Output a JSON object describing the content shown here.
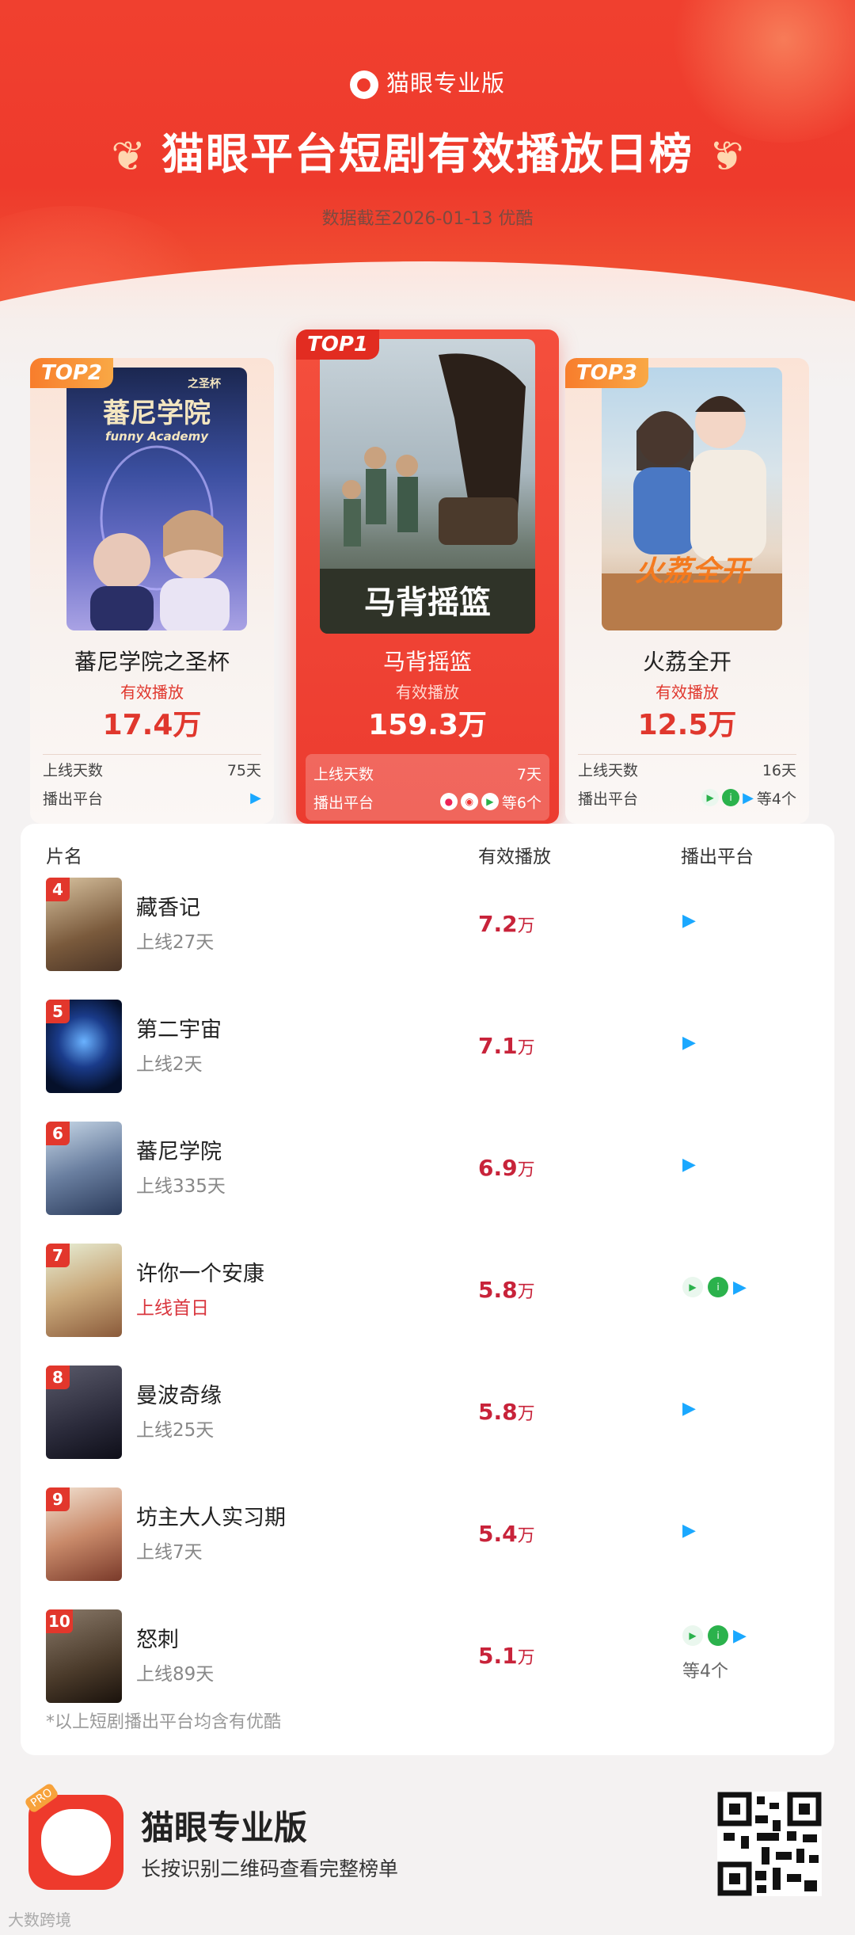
{
  "header": {
    "brand": "猫眼专业版",
    "title": "猫眼平台短剧有效播放日榜",
    "date_note": "数据截至2026-01-13  优酷"
  },
  "top3": [
    {
      "badge": "TOP2",
      "name": "蕃尼学院之圣杯",
      "metric_label": "有效播放",
      "value": "17.4万",
      "days_label": "上线天数",
      "days": "75天",
      "platform_label": "播出平台",
      "more": ""
    },
    {
      "badge": "TOP1",
      "name": "马背摇篮",
      "metric_label": "有效播放",
      "value": "159.3万",
      "days_label": "上线天数",
      "days": "7天",
      "platform_label": "播出平台",
      "more": "等6个"
    },
    {
      "badge": "TOP3",
      "name": "火荔全开",
      "metric_label": "有效播放",
      "value": "12.5万",
      "days_label": "上线天数",
      "days": "16天",
      "platform_label": "播出平台",
      "more": "等4个"
    }
  ],
  "posters": {
    "top2_title": "蕃尼学院",
    "top2_subtitle": "之圣杯",
    "top2_en": "funny Academy",
    "top1_title": "马背摇篮",
    "top3_title": "火荔全开"
  },
  "list": {
    "col_name": "片名",
    "col_play": "有效播放",
    "col_platform": "播出平台",
    "rows": [
      {
        "rank": "4",
        "name": "藏香记",
        "days": "上线27天",
        "value": "7.2",
        "unit": "万",
        "more": ""
      },
      {
        "rank": "5",
        "name": "第二宇宙",
        "days": "上线2天",
        "value": "7.1",
        "unit": "万",
        "more": ""
      },
      {
        "rank": "6",
        "name": "蕃尼学院",
        "days": "上线335天",
        "value": "6.9",
        "unit": "万",
        "more": ""
      },
      {
        "rank": "7",
        "name": "许你一个安康",
        "days": "上线首日",
        "value": "5.8",
        "unit": "万",
        "more": ""
      },
      {
        "rank": "8",
        "name": "曼波奇缘",
        "days": "上线25天",
        "value": "5.8",
        "unit": "万",
        "more": ""
      },
      {
        "rank": "9",
        "name": "坊主大人实习期",
        "days": "上线7天",
        "value": "5.4",
        "unit": "万",
        "more": ""
      },
      {
        "rank": "10",
        "name": "怒刺",
        "days": "上线89天",
        "value": "5.1",
        "unit": "万",
        "more": "等4个"
      }
    ],
    "footnote": "*以上短剧播出平台均含有优酷"
  },
  "footer": {
    "app_name": "猫眼专业版",
    "tagline": "长按识别二维码查看完整榜单",
    "pro_badge": "PRO",
    "watermark": "大数跨境"
  },
  "colors": {
    "brand_red": "#ee3a2c",
    "value_red": "#c8233a",
    "badge_orange": "#f98e38"
  },
  "icons": {
    "youku": "youku-icon",
    "tencent": "tencent-video-icon",
    "iqiyi": "iqiyi-icon",
    "mango": "mango-tv-icon"
  }
}
